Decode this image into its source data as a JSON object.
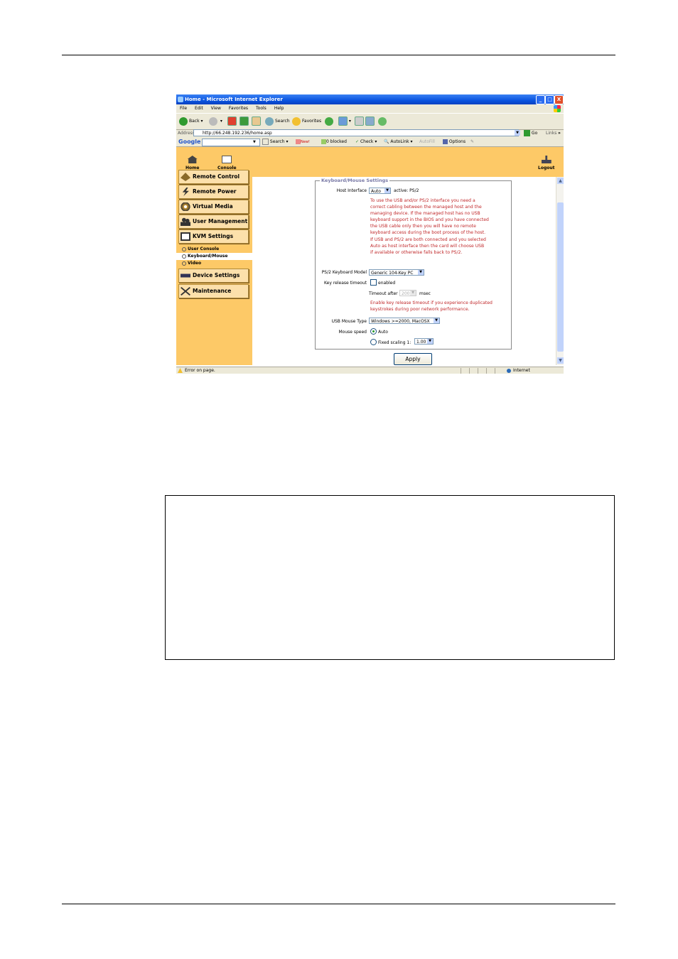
{
  "window": {
    "title": "Home - Microsoft Internet Explorer",
    "buttons": [
      "_",
      "□",
      "X"
    ]
  },
  "menubar": [
    "File",
    "Edit",
    "View",
    "Favorites",
    "Tools",
    "Help"
  ],
  "toolbar": {
    "back": "Back",
    "search": "Search",
    "favorites": "Favorites"
  },
  "address": {
    "label": "Address",
    "url": "http://66.248.192.236/home.asp",
    "go": "Go",
    "links": "Links"
  },
  "google_toolbar": {
    "logo": "Google",
    "search": "Search",
    "new": "New!",
    "blocked": "0 blocked",
    "check": "Check",
    "autolink": "AutoLink",
    "autofill": "AutoFill",
    "options": "Options"
  },
  "nav": {
    "home": "Home",
    "console": "Console",
    "logout": "Logout"
  },
  "sidebar": {
    "partial": "Remote Control",
    "items": [
      {
        "label": "Remote Power"
      },
      {
        "label": "Virtual Media"
      },
      {
        "label": "User Management"
      },
      {
        "label": "KVM Settings"
      }
    ],
    "subitems": [
      {
        "label": "User Console"
      },
      {
        "label": "Keyboard/Mouse"
      },
      {
        "label": "Video"
      }
    ],
    "lower": [
      {
        "label": "Device Settings"
      },
      {
        "label": "Maintenance"
      }
    ]
  },
  "form": {
    "legend": "Keyboard/Mouse Settings",
    "host_interface": {
      "label": "Host Interface",
      "value": "Auto",
      "active": "active: PS/2"
    },
    "host_note": "To use the USB and/or PS/2 interface you need a\ncorrect cabling between the managed host and the\nmanaging device. If the managed host has no USB\nkeyboard support in the BIOS and you have connected\nthe USB cable only then you will have no remote\nkeyboard access during the boot process of the host.\nIf USB and PS/2 are both connected and you selected\nAuto as host interface then the card will choose USB\nif available or otherwise falls back to PS/2.",
    "ps2_model": {
      "label": "PS/2 Keyboard Model",
      "value": "Generic 104-Key PC"
    },
    "key_release": {
      "label": "Key release timeout",
      "checkbox": "enabled",
      "timeout_label": "Timeout after",
      "timeout_value": "200",
      "unit": "msec"
    },
    "key_note": "Enable key release timeout if you experience duplicated\nkeystrokes during poor network performance.",
    "usb_mouse": {
      "label": "USB Mouse Type",
      "value": "Windows >=2000, MacOSX"
    },
    "mouse_speed": {
      "label": "Mouse speed",
      "option_auto": "Auto",
      "option_fixed": "Fixed scaling 1:",
      "fixed_value": "1.00"
    },
    "apply": "Apply"
  },
  "status": {
    "text": "Error on page.",
    "zone": "Internet"
  }
}
